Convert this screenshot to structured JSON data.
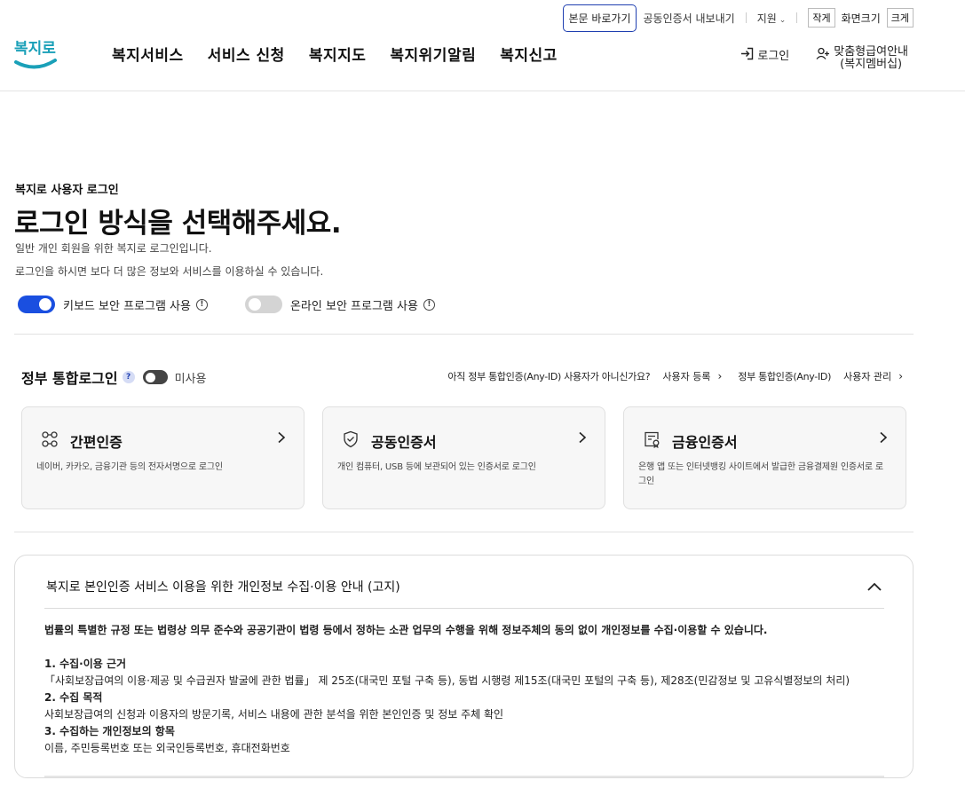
{
  "util": {
    "skip": "본문 바로가기",
    "cert_export": "공동인증서 내보내기",
    "support": "지원",
    "small": "작게",
    "screen_size": "화면크기",
    "large": "크게"
  },
  "logo": {
    "text": "복지로"
  },
  "nav": [
    "복지서비스",
    "서비스 신청",
    "복지지도",
    "복지위기알림",
    "복지신고"
  ],
  "header": {
    "login": "로그인",
    "member_line1": "맞춤형급여안내",
    "member_line2": "(복지멤버십)"
  },
  "intro": {
    "subtitle": "복지로 사용자 로그인",
    "title": "로그인 방식을 선택해주세요.",
    "desc1": "일반 개인 회원을 위한 복지로 로그인입니다.",
    "desc2": "로그인을 하시면 보다 더 많은 정보와 서비스를 이용하실 수 있습니다."
  },
  "toggles": [
    {
      "label": "키보드 보안 프로그램 사용",
      "on": true
    },
    {
      "label": "온라인 보안 프로그램 사용",
      "on": false
    }
  ],
  "gov": {
    "title": "정부 통합로그인",
    "state": "미사용",
    "question": "아직 정부 통합인증(Any-ID) 사용자가 아니신가요?",
    "register": "사용자 등록",
    "manage_prefix": "정부 통합인증(Any-ID)",
    "manage": "사용자 관리"
  },
  "cards": [
    {
      "icon": "simple-auth-icon",
      "title": "간편인증",
      "desc": "네이버, 카카오, 금융기관 등의 전자서명으로 로그인"
    },
    {
      "icon": "shield-check-icon",
      "title": "공동인증서",
      "desc": "개인 컴퓨터, USB 등에 보관되어 있는 인증서로 로그인"
    },
    {
      "icon": "certificate-icon",
      "title": "금융인증서",
      "desc": "은행 앱 또는 인터넷뱅킹 사이트에서 발급한 금융결제원 인증서로 로그인"
    }
  ],
  "notice": {
    "title": "복지로 본인인증 서비스 이용을 위한 개인정보 수집·이용 안내 (고지)",
    "lead": "법률의 특별한 규정 또는 법령상 의무 준수와 공공기관이 법령 등에서 정하는 소관 업무의 수행을 위해 정보주체의 동의 없이 개인정보를 수집·이용할 수 있습니다.",
    "s1_title": "1. 수집·이용 근거",
    "s1_body": "「사회보장급여의 이용·제공 및 수급권자 발굴에 관한 법률」 제 25조(대국민 포털 구축 등), 동법 시행령 제15조(대국민 포털의 구축 등), 제28조(민감정보 및 고유식별정보의 처리)",
    "s2_title": "2. 수집 목적",
    "s2_body": "사회보장급여의 신청과 이용자의 방문기록, 서비스 내용에 관한 분석을 위한 본인인증 및 정보 주체 확인",
    "s3_title": "3. 수집하는 개인정보의 항목",
    "s3_body": "이름, 주민등록번호 또는 외국인등록번호, 휴대전화번호"
  },
  "colors": {
    "accent": "#1a4fe0",
    "logo_teal": "#1aa0b8",
    "logo_blue": "#1f3fb0"
  }
}
